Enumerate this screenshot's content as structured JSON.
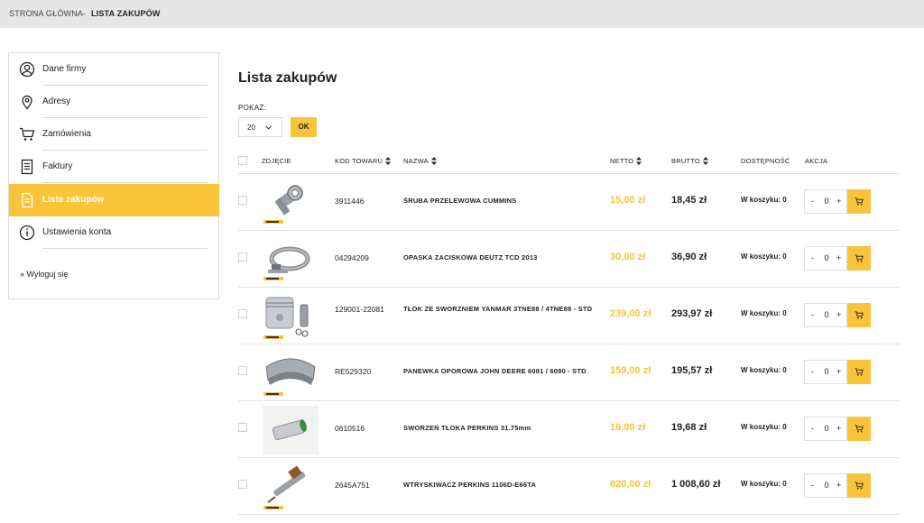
{
  "breadcrumb": {
    "home": "STRONA GŁÓWNA",
    "current": "LISTA ZAKUPÓW"
  },
  "sidebar": {
    "items": [
      {
        "label": "Dane firmy",
        "icon": "user-circle-icon"
      },
      {
        "label": "Adresy",
        "icon": "map-pin-icon"
      },
      {
        "label": "Zamówienia",
        "icon": "cart-icon"
      },
      {
        "label": "Faktury",
        "icon": "invoice-icon"
      },
      {
        "label": "Lista zakupów",
        "icon": "document-icon",
        "active": true
      },
      {
        "label": "Ustawienia konta",
        "icon": "info-circle-icon"
      }
    ],
    "logout": "» Wyloguj się"
  },
  "main": {
    "title": "Lista zakupów",
    "show_label": "POKAŻ:",
    "show_value": "20",
    "ok_label": "OK"
  },
  "table": {
    "headers": {
      "photo": "ZDJĘCIE",
      "code": "KOD TOWARU",
      "name": "NAZWA",
      "net": "NETTO",
      "gross": "BRUTTO",
      "availability": "DOSTĘPNOŚĆ",
      "action": "AKCJA"
    },
    "rows": [
      {
        "image": "banjo-bolt",
        "code": "3911446",
        "name": "ŚRUBA PRZELEWOWA CUMMINS",
        "net": "15,00 zł",
        "gross": "18,45 zł",
        "availability": "W koszyku: 0",
        "qty": "0"
      },
      {
        "image": "clamp",
        "code": "04294209",
        "name": "OPASKA ZACISKOWA DEUTZ TCD 2013",
        "net": "30,00 zł",
        "gross": "36,90 zł",
        "availability": "W koszyku: 0",
        "qty": "0"
      },
      {
        "image": "piston",
        "code": "129001-22081",
        "name": "TŁOK ZE SWORZNIEM YANMAR 3TNE88 / 4TNE88 - STD",
        "net": "239,00 zł",
        "gross": "293,97 zł",
        "availability": "W koszyku: 0",
        "qty": "0"
      },
      {
        "image": "bearing",
        "code": "RE529320",
        "name": "PANEWKA OPOROWA JOHN DEERE 6081 / 6090 - STD",
        "net": "159,00 zł",
        "gross": "195,57 zł",
        "availability": "W koszyku: 0",
        "qty": "0"
      },
      {
        "image": "pin",
        "code": "0610516",
        "name": "SWORZEŃ TŁOKA PERKINS 31.75mm",
        "net": "16,00 zł",
        "gross": "19,68 zł",
        "availability": "W koszyku: 0",
        "qty": "0"
      },
      {
        "image": "injector",
        "code": "2645A751",
        "name": "WTRYSKIWACZ PERKINS 1106D-E66TA",
        "net": "820,00 zł",
        "gross": "1 008,60 zł",
        "availability": "W koszyku: 0",
        "qty": "0"
      }
    ],
    "minus_label": "-",
    "plus_label": "+"
  },
  "colors": {
    "accent": "#f9c33a",
    "breadcrumb_bg": "#e6e6e6",
    "border": "#dcdcdc"
  }
}
